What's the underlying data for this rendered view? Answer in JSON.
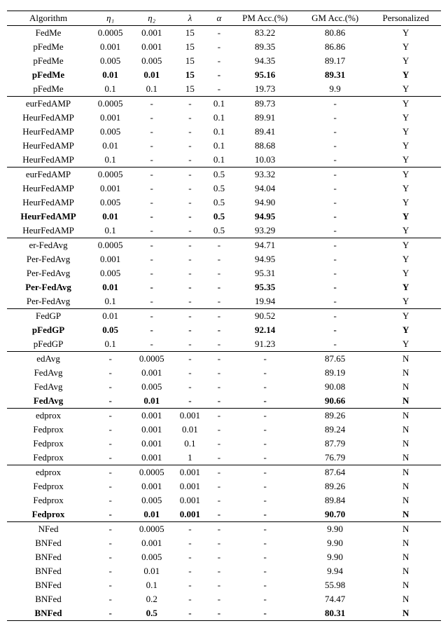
{
  "headers": [
    "Algorithm",
    "η₁",
    "η₂",
    "λ",
    "α",
    "PM Acc.(%)",
    "GM Acc.(%)",
    "Personalized"
  ],
  "groups": [
    [
      {
        "cells": [
          "FedMe",
          "0.0005",
          "0.001",
          "15",
          "-",
          "83.22",
          "80.86",
          "Y"
        ],
        "bold": false
      },
      {
        "cells": [
          "pFedMe",
          "0.001",
          "0.001",
          "15",
          "-",
          "89.35",
          "86.86",
          "Y"
        ],
        "bold": false
      },
      {
        "cells": [
          "pFedMe",
          "0.005",
          "0.005",
          "15",
          "-",
          "94.35",
          "89.17",
          "Y"
        ],
        "bold": false
      },
      {
        "cells": [
          "pFedMe",
          "0.01",
          "0.01",
          "15",
          "-",
          "95.16",
          "89.31",
          "Y"
        ],
        "bold": true
      },
      {
        "cells": [
          "pFedMe",
          "0.1",
          "0.1",
          "15",
          "-",
          "19.73",
          "9.9",
          "Y"
        ],
        "bold": false
      }
    ],
    [
      {
        "cells": [
          "eurFedAMP",
          "0.0005",
          "-",
          "-",
          "0.1",
          "89.73",
          "-",
          "Y"
        ],
        "bold": false
      },
      {
        "cells": [
          "HeurFedAMP",
          "0.001",
          "-",
          "-",
          "0.1",
          "89.91",
          "-",
          "Y"
        ],
        "bold": false
      },
      {
        "cells": [
          "HeurFedAMP",
          "0.005",
          "-",
          "-",
          "0.1",
          "89.41",
          "-",
          "Y"
        ],
        "bold": false
      },
      {
        "cells": [
          "HeurFedAMP",
          "0.01",
          "-",
          "-",
          "0.1",
          "88.68",
          "-",
          "Y"
        ],
        "bold": false
      },
      {
        "cells": [
          "HeurFedAMP",
          "0.1",
          "-",
          "-",
          "0.1",
          "10.03",
          "-",
          "Y"
        ],
        "bold": false
      }
    ],
    [
      {
        "cells": [
          "eurFedAMP",
          "0.0005",
          "-",
          "-",
          "0.5",
          "93.32",
          "-",
          "Y"
        ],
        "bold": false
      },
      {
        "cells": [
          "HeurFedAMP",
          "0.001",
          "-",
          "-",
          "0.5",
          "94.04",
          "-",
          "Y"
        ],
        "bold": false
      },
      {
        "cells": [
          "HeurFedAMP",
          "0.005",
          "-",
          "-",
          "0.5",
          "94.90",
          "-",
          "Y"
        ],
        "bold": false
      },
      {
        "cells": [
          "HeurFedAMP",
          "0.01",
          "-",
          "-",
          "0.5",
          "94.95",
          "-",
          "Y"
        ],
        "bold": true
      },
      {
        "cells": [
          "HeurFedAMP",
          "0.1",
          "-",
          "-",
          "0.5",
          "93.29",
          "-",
          "Y"
        ],
        "bold": false
      }
    ],
    [
      {
        "cells": [
          "er-FedAvg",
          "0.0005",
          "-",
          "-",
          "-",
          "94.71",
          "-",
          "Y"
        ],
        "bold": false
      },
      {
        "cells": [
          "Per-FedAvg",
          "0.001",
          "-",
          "-",
          "-",
          "94.95",
          "-",
          "Y"
        ],
        "bold": false
      },
      {
        "cells": [
          "Per-FedAvg",
          "0.005",
          "-",
          "-",
          "-",
          "95.31",
          "-",
          "Y"
        ],
        "bold": false
      },
      {
        "cells": [
          "Per-FedAvg",
          "0.01",
          "-",
          "-",
          "-",
          "95.35",
          "-",
          "Y"
        ],
        "bold": true
      },
      {
        "cells": [
          "Per-FedAvg",
          "0.1",
          "-",
          "-",
          "-",
          "19.94",
          "-",
          "Y"
        ],
        "bold": false
      }
    ],
    [
      {
        "cells": [
          "FedGP",
          "0.01",
          "-",
          "-",
          "-",
          "90.52",
          "-",
          "Y"
        ],
        "bold": false
      },
      {
        "cells": [
          "pFedGP",
          "0.05",
          "-",
          "-",
          "-",
          "92.14",
          "-",
          "Y"
        ],
        "bold": true
      },
      {
        "cells": [
          "pFedGP",
          "0.1",
          "-",
          "-",
          "-",
          "91.23",
          "-",
          "Y"
        ],
        "bold": false
      }
    ],
    [
      {
        "cells": [
          "edAvg",
          "-",
          "0.0005",
          "-",
          "-",
          "-",
          "87.65",
          "N"
        ],
        "bold": false
      },
      {
        "cells": [
          "FedAvg",
          "-",
          "0.001",
          "-",
          "-",
          "-",
          "89.19",
          "N"
        ],
        "bold": false
      },
      {
        "cells": [
          "FedAvg",
          "-",
          "0.005",
          "-",
          "-",
          "-",
          "90.08",
          "N"
        ],
        "bold": false
      },
      {
        "cells": [
          "FedAvg",
          "-",
          "0.01",
          "-",
          "-",
          "-",
          "90.66",
          "N"
        ],
        "bold": true
      }
    ],
    [
      {
        "cells": [
          "edprox",
          "-",
          "0.001",
          "0.001",
          "-",
          "-",
          "89.26",
          "N"
        ],
        "bold": false
      },
      {
        "cells": [
          "Fedprox",
          "-",
          "0.001",
          "0.01",
          "-",
          "-",
          "89.24",
          "N"
        ],
        "bold": false
      },
      {
        "cells": [
          "Fedprox",
          "-",
          "0.001",
          "0.1",
          "-",
          "-",
          "87.79",
          "N"
        ],
        "bold": false
      },
      {
        "cells": [
          "Fedprox",
          "-",
          "0.001",
          "1",
          "-",
          "-",
          "76.79",
          "N"
        ],
        "bold": false
      }
    ],
    [
      {
        "cells": [
          "edprox",
          "-",
          "0.0005",
          "0.001",
          "-",
          "-",
          "87.64",
          "N"
        ],
        "bold": false
      },
      {
        "cells": [
          "Fedprox",
          "-",
          "0.001",
          "0.001",
          "-",
          "-",
          "89.26",
          "N"
        ],
        "bold": false
      },
      {
        "cells": [
          "Fedprox",
          "-",
          "0.005",
          "0.001",
          "-",
          "-",
          "89.84",
          "N"
        ],
        "bold": false
      },
      {
        "cells": [
          "Fedprox",
          "-",
          "0.01",
          "0.001",
          "-",
          "-",
          "90.70",
          "N"
        ],
        "bold": true
      }
    ],
    [
      {
        "cells": [
          "NFed",
          "-",
          "0.0005",
          "-",
          "-",
          "-",
          "9.90",
          "N"
        ],
        "bold": false
      },
      {
        "cells": [
          "BNFed",
          "-",
          "0.001",
          "-",
          "-",
          "-",
          "9.90",
          "N"
        ],
        "bold": false
      },
      {
        "cells": [
          "BNFed",
          "-",
          "0.005",
          "-",
          "-",
          "-",
          "9.90",
          "N"
        ],
        "bold": false
      },
      {
        "cells": [
          "BNFed",
          "-",
          "0.01",
          "-",
          "-",
          "-",
          "9.94",
          "N"
        ],
        "bold": false
      },
      {
        "cells": [
          "BNFed",
          "-",
          "0.1",
          "-",
          "-",
          "-",
          "55.98",
          "N"
        ],
        "bold": false
      },
      {
        "cells": [
          "BNFed",
          "-",
          "0.2",
          "-",
          "-",
          "-",
          "74.47",
          "N"
        ],
        "bold": false
      },
      {
        "cells": [
          "BNFed",
          "-",
          "0.5",
          "-",
          "-",
          "-",
          "80.31",
          "N"
        ],
        "bold": true
      }
    ]
  ]
}
